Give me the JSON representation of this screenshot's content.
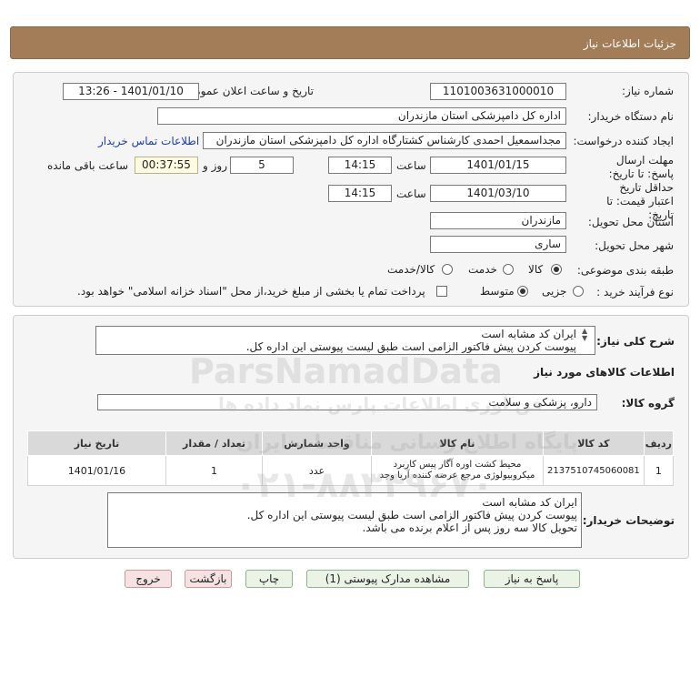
{
  "header": {
    "title": "جزئیات اطلاعات نیاز"
  },
  "form": {
    "need_number_label": "شماره نیاز:",
    "need_number": "1101003631000010",
    "announce_label": "تاریخ و ساعت اعلان عمومی:",
    "announce_value": "1401/01/10 - 13:26",
    "buyer_org_label": "نام دستگاه خریدار:",
    "buyer_org": "اداره کل دامپزشکی استان مازندران",
    "creator_label": "ایجاد کننده درخواست:",
    "creator": "مجداسمعیل احمدی کارشناس کشتارگاه اداره کل دامپزشکی استان مازندران",
    "contact_link": "اطلاعات تماس خریدار",
    "deadline_label": "مهلت ارسال پاسخ: تا تاریخ:",
    "deadline_date": "1401/01/15",
    "time_label": "ساعت",
    "deadline_time": "14:15",
    "days_value": "5",
    "days_label": "روز و",
    "remaining_value": "00:37:55",
    "remaining_label": "ساعت باقی مانده",
    "validity_label": "حداقل تاریخ اعتبار قیمت: تا تاریخ:",
    "validity_date": "1401/03/10",
    "validity_time": "14:15",
    "province_label": "استان محل تحویل:",
    "province": "مازندران",
    "city_label": "شهر محل تحویل:",
    "city": "ساری",
    "category_label": "طبقه بندی موضوعی:",
    "category_options": [
      "کالا",
      "خدمت",
      "کالا/خدمت"
    ],
    "category_selected": "کالا",
    "process_label": "نوع فرآیند خرید :",
    "process_options": [
      "جزیی",
      "متوسط"
    ],
    "process_selected": "متوسط",
    "payment_note": "پرداخت تمام یا بخشی از مبلغ خرید،از محل \"اسناد خزانه اسلامی\" خواهد بود."
  },
  "summary": {
    "label": "شرح کلی نیاز:",
    "lines": [
      "ایران کد مشابه است",
      "پیوست کردن پیش فاکتور الزامی است طبق لیست پیوستی این اداره کل."
    ]
  },
  "goods": {
    "section_title": "اطلاعات کالاهای مورد نیاز",
    "group_label": "گروه کالا:",
    "group_value": "دارو، پزشکی و سلامت",
    "columns": [
      "ردیف",
      "کد کالا",
      "نام کالا",
      "واحد شمارش",
      "تعداد / مقدار",
      "تاریخ نیاز"
    ],
    "rows": [
      {
        "row": "1",
        "code": "2137510745060081",
        "name": "محیط کشت اوره آگار پیس کاربرد میکروبیولوژی مرجع عرضه کننده آریا وجد",
        "unit": "عدد",
        "qty": "1",
        "date": "1401/01/16"
      }
    ]
  },
  "buyer_notes": {
    "label": "توضیحات خریدار:",
    "lines": [
      "ایران کد مشابه است",
      "پیوست کردن پیش فاکتور الزامی است طبق لیست پیوستی این اداره کل.",
      " تحویل کالا سه روز پس از اعلام برنده می باشد."
    ]
  },
  "buttons": {
    "reply": "پاسخ به نیاز",
    "attachments": "مشاهده مدارک پیوستی (1)",
    "print": "چاپ",
    "back": "بازگشت",
    "exit": "خروج"
  },
  "colors": {
    "header_bg": "#a27d58",
    "button_green": "#eaf3e6",
    "button_pink": "#f6e2e2",
    "link_blue": "#1a3fb0"
  },
  "watermark": {
    "brand": "ParsNamadData",
    "tagline": "پایگاه اطلاع رسانی مناقصات ایران",
    "subline": "فن آوری اطلاعات پارس نماد داده ها",
    "phone": "۰۲۱-۸۸۳۴۹۶۷۰"
  }
}
